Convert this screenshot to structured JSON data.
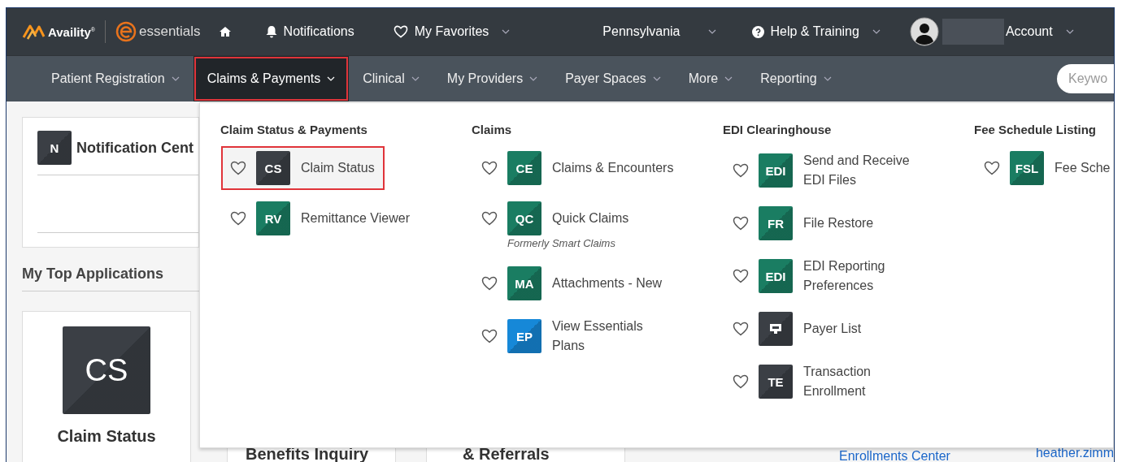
{
  "top_bar": {
    "brand": "Availity",
    "brand_mark": "®",
    "product": "essentials",
    "notifications": "Notifications",
    "favorites": "My Favorites",
    "region": "Pennsylvania",
    "help": "Help & Training",
    "account": "Account"
  },
  "nav": [
    {
      "label": "Patient Registration",
      "selected": false,
      "highlighted": false
    },
    {
      "label": "Claims & Payments",
      "selected": true,
      "highlighted": true
    },
    {
      "label": "Clinical",
      "selected": false,
      "highlighted": false
    },
    {
      "label": "My Providers",
      "selected": false,
      "highlighted": false
    },
    {
      "label": "Payer Spaces",
      "selected": false,
      "highlighted": false
    },
    {
      "label": "More",
      "selected": false,
      "highlighted": false
    },
    {
      "label": "Reporting",
      "selected": false,
      "highlighted": false
    }
  ],
  "search": {
    "placeholder": "Keywo"
  },
  "notification_card": {
    "badge": "N",
    "title": "Notification Cent"
  },
  "top_apps": {
    "heading": "My Top Applications",
    "tile": "CS",
    "name": "Claim Status"
  },
  "lower_row": {
    "card_1": "Benefits Inquiry",
    "card_2": "& Referrals",
    "link": "Enrollments Center",
    "user": "heather.zimm"
  },
  "menu": [
    {
      "heading": "Claim Status & Payments",
      "items": [
        {
          "kind": "text",
          "tile": "CS",
          "color": "#3b3f45",
          "label": "Claim Status",
          "highlighted": true
        },
        {
          "kind": "text",
          "tile": "RV",
          "color": "#1a7d62",
          "label": "Remittance Viewer",
          "highlighted": false
        }
      ]
    },
    {
      "heading": "Claims",
      "items": [
        {
          "kind": "text",
          "tile": "CE",
          "color": "#1a7d62",
          "label": "Claims & Encounters",
          "highlighted": false
        },
        {
          "kind": "text",
          "tile": "QC",
          "color": "#1a7d62",
          "label": "Quick Claims",
          "note": "Formerly Smart Claims",
          "highlighted": false
        },
        {
          "kind": "text",
          "tile": "MA",
          "color": "#1a7d62",
          "label": "Attachments - New",
          "highlighted": false
        },
        {
          "kind": "text",
          "tile": "EP",
          "color": "#1688d8",
          "label": "View Essentials\nPlans",
          "highlighted": false
        }
      ]
    },
    {
      "heading": "EDI Clearinghouse",
      "items": [
        {
          "kind": "text",
          "tile": "EDI",
          "color": "#1a7d62",
          "label": "Send and Receive\nEDI Files",
          "highlighted": false
        },
        {
          "kind": "text",
          "tile": "FR",
          "color": "#1a7d62",
          "label": "File Restore",
          "highlighted": false
        },
        {
          "kind": "text",
          "tile": "EDI",
          "color": "#1a7d62",
          "label": "EDI Reporting\nPreferences",
          "highlighted": false
        },
        {
          "kind": "icon",
          "color": "#3b3f45",
          "label": "Payer List",
          "highlighted": false
        },
        {
          "kind": "text",
          "tile": "TE",
          "color": "#3b3f45",
          "label": "Transaction\nEnrollment",
          "highlighted": false
        }
      ]
    },
    {
      "heading": "Fee Schedule Listing",
      "items": [
        {
          "kind": "text",
          "tile": "FSL",
          "color": "#1a7d62",
          "label": "Fee Sche",
          "highlighted": false
        }
      ]
    }
  ]
}
